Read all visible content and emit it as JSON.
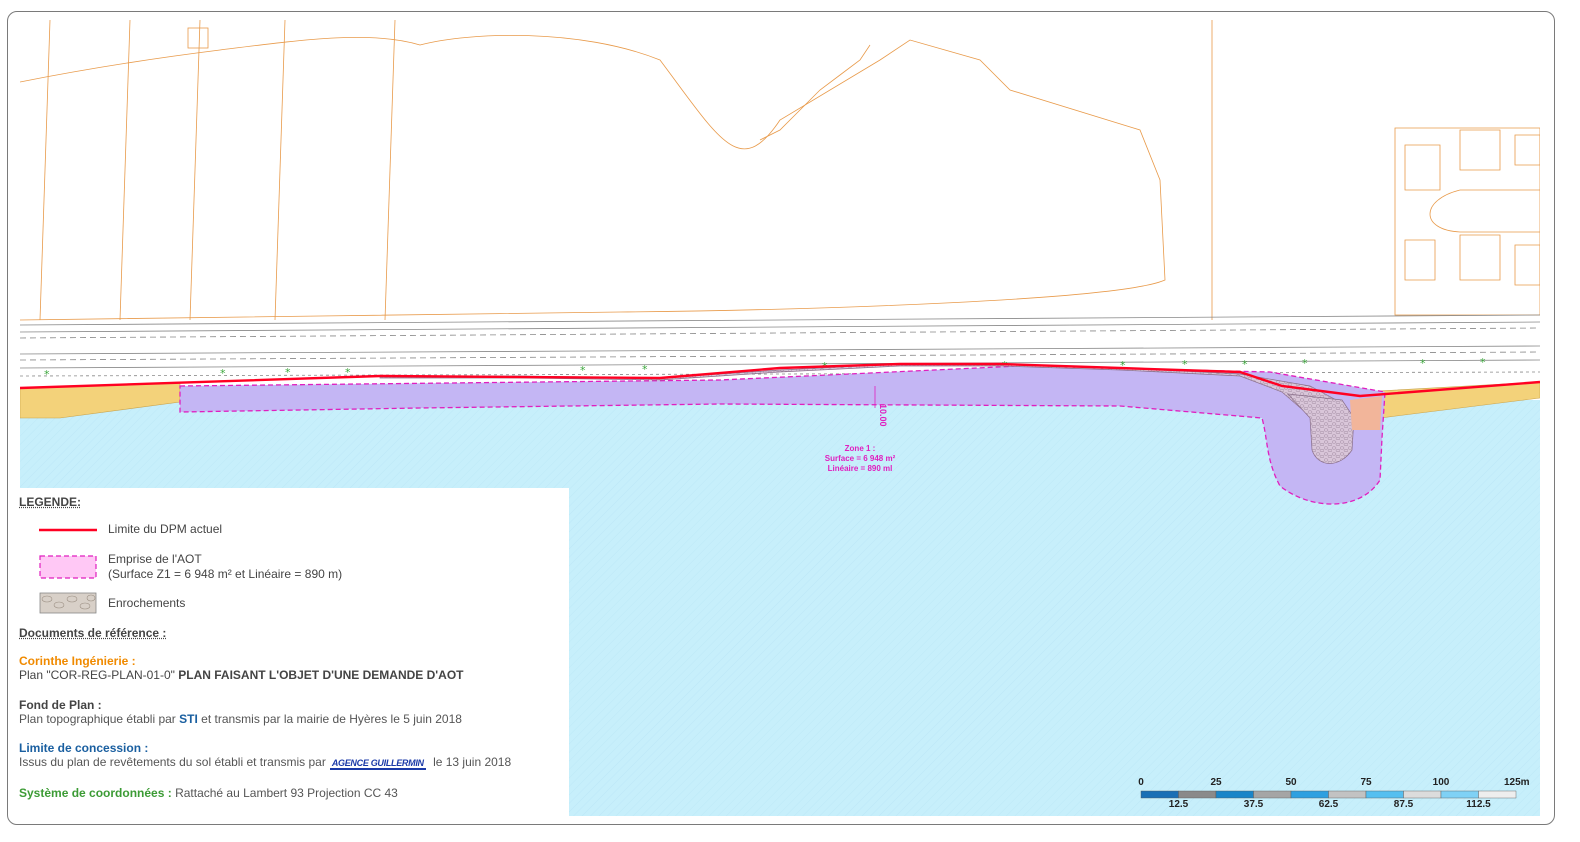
{
  "map": {
    "zone_label": {
      "title": "Zone 1 :",
      "surface": "Surface = 6 948 m²",
      "lineaire": "Linéaire = 890 ml"
    },
    "dimension_label": "10.00"
  },
  "legend": {
    "title": "LEGENDE:",
    "items": [
      {
        "label": "Limite du DPM actuel",
        "color": "#ff0000"
      },
      {
        "label": "Emprise de l'AOT",
        "sublabel": "(Surface Z1 = 6 948 m² et Linéaire = 890 m)",
        "color": "#e01fbf"
      },
      {
        "label": "Enrochements"
      }
    ]
  },
  "references": {
    "title": "Documents de référence :",
    "corinthe": {
      "heading": "Corinthe Ingénierie :",
      "prefix": "Plan \"COR-REG-PLAN-01-0\"",
      "bold": "PLAN FAISANT L'OBJET D'UNE DEMANDE D'AOT"
    },
    "fond": {
      "heading": "Fond de Plan :",
      "prefix": "Plan topographique établi par",
      "sti": "STI",
      "suffix": "et transmis par la mairie de Hyères le 5 juin 2018"
    },
    "concession": {
      "heading": "Limite de concession :",
      "prefix": "Issus du plan de revêtements du sol établi et transmis par",
      "logo_text": "AGENCE GUILLERMIN",
      "suffix": "le 13 juin 2018"
    },
    "systeme": {
      "heading": "Système de coordonnées :",
      "value": "Rattaché au Lambert 93 Projection CC 43"
    }
  },
  "scale_bar": {
    "top_ticks": [
      "0",
      "25",
      "50",
      "75",
      "100",
      "125m"
    ],
    "bottom_ticks": [
      "12.5",
      "37.5",
      "62.5",
      "87.5",
      "112.5"
    ]
  }
}
